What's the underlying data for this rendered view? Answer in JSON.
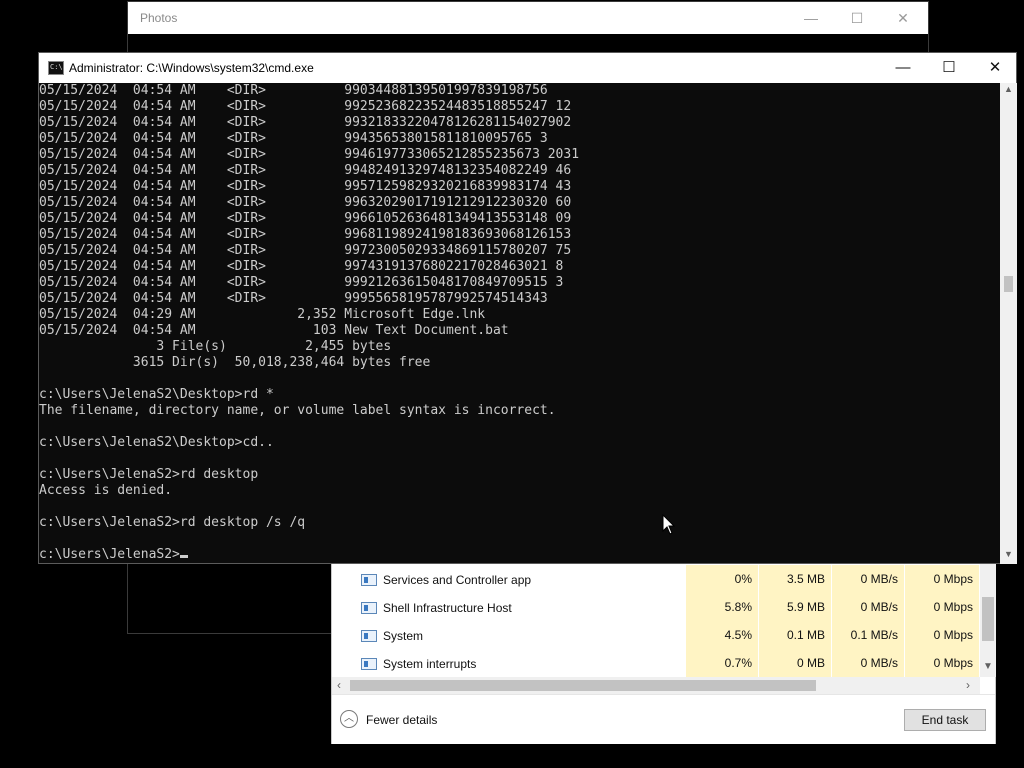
{
  "photos_window": {
    "title": "Photos",
    "minimize_glyph": "—",
    "maximize_glyph": "☐",
    "close_glyph": "✕"
  },
  "cmd_window": {
    "title": "Administrator: C:\\Windows\\system32\\cmd.exe",
    "minimize_glyph": "—",
    "maximize_glyph": "☐",
    "close_glyph": "✕",
    "lines": [
      "05/15/2024  04:54 AM    <DIR>          99034488139501997839198756",
      "05/15/2024  04:54 AM    <DIR>          99252368223524483518855247 12",
      "05/15/2024  04:54 AM    <DIR>          99321833220478126281154027902",
      "05/15/2024  04:54 AM    <DIR>          994356538015811810095765 3",
      "05/15/2024  04:54 AM    <DIR>          9946197733065212855235673 2031",
      "05/15/2024  04:54 AM    <DIR>          99482491329748132354082249 46",
      "05/15/2024  04:54 AM    <DIR>          99571259829320216839983174 43",
      "05/15/2024  04:54 AM    <DIR>          99632029017191212912230320 60",
      "05/15/2024  04:54 AM    <DIR>          99661052636481349413553148 09",
      "05/15/2024  04:54 AM    <DIR>          99681198924198183693068126153",
      "05/15/2024  04:54 AM    <DIR>          99723005029334869115780207 75",
      "05/15/2024  04:54 AM    <DIR>          99743191376802217028463021 8",
      "05/15/2024  04:54 AM    <DIR>          99921263615048170849709515 3",
      "05/15/2024  04:54 AM    <DIR>          99955658195787992574514343",
      "05/15/2024  04:29 AM             2,352 Microsoft Edge.lnk",
      "05/15/2024  04:54 AM               103 New Text Document.bat",
      "               3 File(s)          2,455 bytes",
      "            3615 Dir(s)  50,018,238,464 bytes free",
      "",
      "c:\\Users\\JelenaS2\\Desktop>rd *",
      "The filename, directory name, or volume label syntax is incorrect.",
      "",
      "c:\\Users\\JelenaS2\\Desktop>cd..",
      "",
      "c:\\Users\\JelenaS2>rd desktop",
      "Access is denied.",
      "",
      "c:\\Users\\JelenaS2>rd desktop /s /q",
      ""
    ],
    "prompt": "c:\\Users\\JelenaS2>"
  },
  "task_manager": {
    "rows": [
      {
        "name": "Services and Controller app",
        "cpu": "0%",
        "memory": "3.5 MB",
        "disk": "0 MB/s",
        "network": "0 Mbps"
      },
      {
        "name": "Shell Infrastructure Host",
        "cpu": "5.8%",
        "memory": "5.9 MB",
        "disk": "0 MB/s",
        "network": "0 Mbps"
      },
      {
        "name": "System",
        "cpu": "4.5%",
        "memory": "0.1 MB",
        "disk": "0.1 MB/s",
        "network": "0 Mbps"
      },
      {
        "name": "System interrupts",
        "cpu": "0.7%",
        "memory": "0 MB",
        "disk": "0 MB/s",
        "network": "0 Mbps"
      }
    ],
    "fewer_details": "Fewer details",
    "end_task": "End task"
  },
  "colors": {
    "console_bg": "#0c0c0c",
    "console_text": "#cccccc",
    "heat_cell": "#fff4c4"
  }
}
